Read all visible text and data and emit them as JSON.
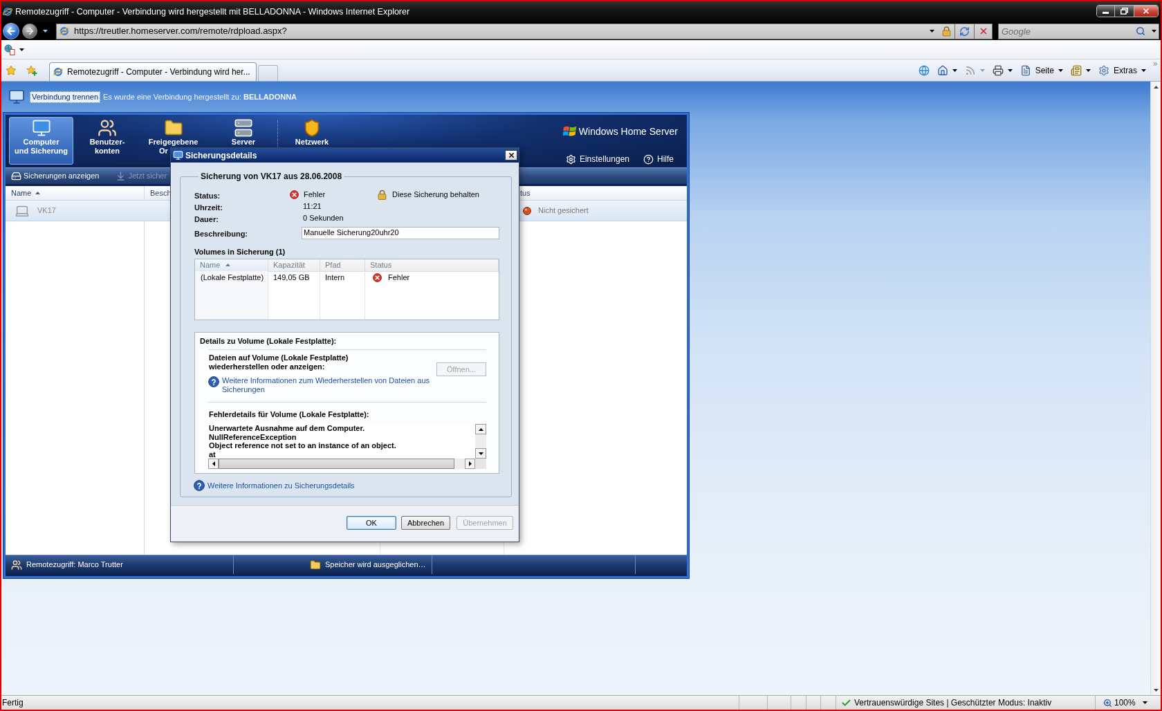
{
  "browser": {
    "title": "Remotezugriff - Computer - Verbindung wird hergestellt mit BELLADONNA - Windows Internet Explorer",
    "nav_buttons": [
      {
        "kind": "back",
        "disabled": false
      },
      {
        "kind": "forward",
        "disabled": true
      }
    ],
    "address": {
      "value": "https://treutler.homeserver.com/remote/rdpload.aspx?"
    },
    "search": {
      "placeholder": "Google"
    },
    "tabs": [
      {
        "label": "Remotezugriff - Computer - Verbindung wird her...",
        "selected": true
      }
    ],
    "command_buttons": [
      {
        "kind": "connection",
        "disabled": false
      },
      {
        "kind": "home",
        "disabled": false
      },
      {
        "kind": "feeds",
        "disabled": true
      },
      {
        "kind": "print",
        "disabled": false
      },
      {
        "kind": "page",
        "label": "Seite",
        "disabled": false
      },
      {
        "kind": "research",
        "disabled": false
      },
      {
        "kind": "tools",
        "label": "Extras",
        "disabled": false
      }
    ],
    "status_bar": {
      "text": "Fertig",
      "zone": "Vertrauenswürdige Sites | Geschützter Modus: Inaktiv",
      "zoom": "100%"
    }
  },
  "connection_bar": {
    "link": "Verbindung trennen",
    "message": "Es wurde eine Verbindung hergestellt zu: **BELLADONNA**"
  },
  "console": {
    "tabs": [
      {
        "kind": "computer",
        "lines": [
          "Computer",
          "und Sicherung"
        ],
        "selected": true
      },
      {
        "kind": "users",
        "lines": [
          "Benutzer-",
          "konten"
        ],
        "selected": false
      },
      {
        "kind": "folder",
        "lines": [
          "Freigegebene",
          "Or"
        ],
        "selected": false
      },
      {
        "kind": "server",
        "lines": [
          "Server"
        ],
        "selected": false
      },
      {
        "kind": "network",
        "lines": [
          "Netzwerk"
        ],
        "selected": false
      }
    ],
    "logo": "Windows Home Server",
    "header_links": [
      {
        "kind": "settings",
        "label": "Einstellungen"
      },
      {
        "kind": "help",
        "label": "Hilfe"
      }
    ],
    "toolbar": [
      {
        "kind": "view",
        "label": "Sicherungen anzeigen",
        "disabled": false
      },
      {
        "kind": "backup",
        "label": "Jetzt sicher",
        "disabled": true
      }
    ],
    "columns": [
      {
        "label": "Name",
        "sorted": true
      },
      {
        "label": "Besch",
        "sorted": false
      },
      {
        "label": "tus",
        "sorted": false
      }
    ],
    "rows": [
      {
        "name": "VK17",
        "status": "Nicht gesichert",
        "selected": true
      }
    ],
    "status_bar": [
      {
        "kind": "users",
        "text": "Remotezugriff: Marco Trutter"
      },
      {
        "kind": "storage",
        "text": "Speicher wird ausgeglichen…"
      }
    ]
  },
  "dialog": {
    "title": "Sicherungsdetails",
    "group_title": "Sicherung von VK17 aus 28.06.2008",
    "fields": [
      {
        "kind": "status",
        "label": "Status:",
        "value": "Fehler"
      },
      {
        "kind": "text",
        "label": "Uhrzeit:",
        "value": "11:21"
      },
      {
        "kind": "text",
        "label": "Dauer:",
        "value": "0 Sekunden"
      },
      {
        "kind": "input",
        "label": "Beschreibung:",
        "value": "Manuelle Sicherung20uhr20"
      }
    ],
    "keep_label": "Diese Sicherung behalten",
    "volumes_title": "Volumes in Sicherung (1)",
    "volume_columns": [
      {
        "label": "Name",
        "sorted": true
      },
      {
        "label": "Kapazität",
        "sorted": false
      },
      {
        "label": "Pfad",
        "sorted": false
      },
      {
        "label": "Status",
        "sorted": false
      }
    ],
    "volume_rows": [
      {
        "name": "(Lokale Festplatte)",
        "capacity": "149,05 GB",
        "path": "Intern",
        "status": "Fehler"
      }
    ],
    "details": {
      "title": "Details zu Volume (Lokale Festplatte):",
      "restore_text": "Dateien auf Volume (Lokale Festplatte) wiederherstellen oder anzeigen:",
      "open_button": {
        "label": "Öffnen...",
        "disabled": true
      },
      "restore_link": "Weitere Informationen zum Wiederherstellen von Dateien aus Sicherungen",
      "error_title": "Fehlerdetails für Volume (Lokale Festplatte):",
      "error_lines": [
        "Unerwartete Ausnahme auf dem Computer.",
        "NullReferenceException",
        "Object reference not set to an instance of an object.",
        "at"
      ]
    },
    "help_link": "Weitere Informationen zu Sicherungsdetails",
    "buttons": [
      {
        "label": "OK",
        "disabled": false,
        "default": true
      },
      {
        "label": "Abbrechen",
        "disabled": false,
        "default": false
      },
      {
        "label": "Übernehmen",
        "disabled": true,
        "default": false
      }
    ]
  }
}
